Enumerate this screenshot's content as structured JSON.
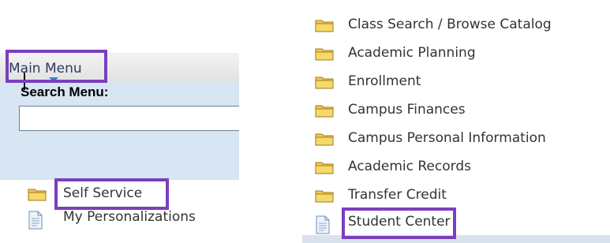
{
  "left_menu": {
    "title": "Main Menu",
    "search_label": "Search Menu:",
    "search_value": "",
    "items": [
      {
        "label": "Self Service",
        "icon": "folder-icon",
        "highlighted": true
      },
      {
        "label": "My Personalizations",
        "icon": "document-icon",
        "highlighted": false
      }
    ]
  },
  "right_menu": {
    "items": [
      {
        "label": "Class Search / Browse Catalog",
        "icon": "folder-icon"
      },
      {
        "label": "Academic Planning",
        "icon": "folder-icon"
      },
      {
        "label": "Enrollment",
        "icon": "folder-icon"
      },
      {
        "label": "Campus Finances",
        "icon": "folder-icon"
      },
      {
        "label": "Campus Personal Information",
        "icon": "folder-icon"
      },
      {
        "label": "Academic Records",
        "icon": "folder-icon"
      },
      {
        "label": "Transfer Credit",
        "icon": "folder-icon"
      },
      {
        "label": "Student Center",
        "icon": "document-icon",
        "highlighted": true
      }
    ]
  },
  "colors": {
    "highlight": "#7a3fbd",
    "folder": "#f2c94c",
    "search_area": "#d8e5f2",
    "menu_title": "#2b3c5e"
  }
}
